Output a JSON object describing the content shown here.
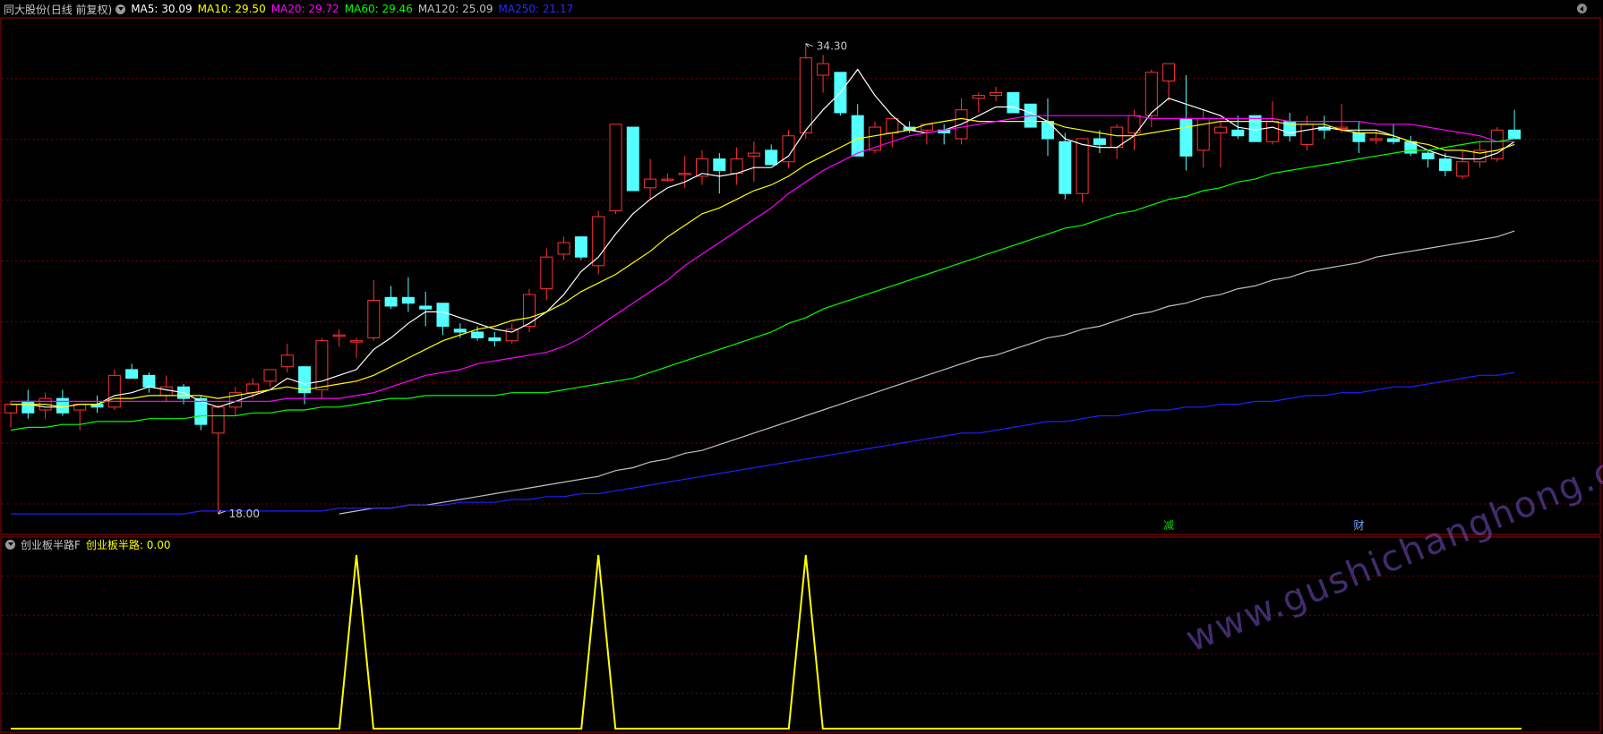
{
  "header": {
    "stock_name": "同大股份",
    "period": "(日线 前复权)",
    "ma5_label": "MA5:",
    "ma5_value": "30.09",
    "ma10_label": "MA10:",
    "ma10_value": "29.50",
    "ma20_label": "MA20:",
    "ma20_value": "29.72",
    "ma60_label": "MA60:",
    "ma60_value": "29.46",
    "ma120_label": "MA120:",
    "ma120_value": "25.09",
    "ma250_label": "MA250:",
    "ma250_value": "21.17"
  },
  "indicator": {
    "name": "创业板半路F",
    "line_label": "创业板半路:",
    "line_value": "0.00"
  },
  "markers": {
    "high_label": "34.30",
    "low_label": "18.00",
    "event1": "减",
    "event2": "财"
  },
  "watermark": "www.gushichanghong.com",
  "colors": {
    "up": "#ff3232",
    "down": "#54ffff",
    "ma5": "#ffffff",
    "ma10": "#ffff00",
    "ma20": "#ff00ff",
    "ma60": "#00ff00",
    "ma120": "#c0c0c0",
    "ma250": "#2020ff",
    "grid": "#7a0000",
    "indicator": "#ffff00"
  },
  "chart_data": [
    {
      "type": "candlestick",
      "title": "同大股份 (日线 前复权)",
      "y_range": [
        17.6,
        35.0
      ],
      "max_price": 34.3,
      "min_price": 18.0,
      "candles": [
        [
          21.5,
          21.9,
          21.0,
          21.8
        ],
        [
          21.9,
          22.3,
          21.3,
          21.5
        ],
        [
          21.6,
          22.2,
          21.3,
          22.0
        ],
        [
          22.0,
          22.3,
          21.4,
          21.5
        ],
        [
          21.6,
          21.8,
          20.9,
          21.8
        ],
        [
          21.8,
          22.1,
          21.5,
          21.7
        ],
        [
          21.7,
          23.0,
          21.6,
          22.8
        ],
        [
          23.0,
          23.2,
          22.7,
          22.7
        ],
        [
          22.8,
          22.9,
          22.2,
          22.4
        ],
        [
          22.1,
          22.8,
          21.9,
          22.4
        ],
        [
          22.4,
          22.5,
          21.8,
          22.0
        ],
        [
          22.0,
          22.1,
          20.9,
          21.1
        ],
        [
          20.8,
          21.8,
          18.0,
          21.7
        ],
        [
          21.7,
          22.4,
          21.4,
          22.2
        ],
        [
          22.2,
          22.7,
          22.0,
          22.5
        ],
        [
          22.6,
          23.0,
          22.4,
          23.0
        ],
        [
          23.1,
          23.9,
          22.9,
          23.5
        ],
        [
          23.1,
          22.2,
          21.8,
          22.2
        ],
        [
          22.3,
          24.1,
          22.0,
          24.0
        ],
        [
          24.2,
          24.4,
          23.8,
          24.2
        ],
        [
          24.0,
          24.1,
          23.4,
          24.0
        ],
        [
          24.1,
          26.1,
          24.0,
          25.4
        ],
        [
          25.5,
          25.9,
          25.1,
          25.2
        ],
        [
          25.5,
          26.2,
          25.0,
          25.3
        ],
        [
          25.2,
          25.7,
          24.5,
          25.1
        ],
        [
          25.3,
          25.3,
          24.2,
          24.5
        ],
        [
          24.4,
          24.6,
          24.1,
          24.3
        ],
        [
          24.3,
          24.5,
          24.0,
          24.1
        ],
        [
          24.1,
          24.3,
          23.8,
          24.0
        ],
        [
          24.0,
          24.6,
          23.9,
          24.4
        ],
        [
          24.5,
          25.8,
          24.3,
          25.6
        ],
        [
          25.8,
          27.2,
          25.4,
          26.9
        ],
        [
          27.0,
          27.6,
          26.8,
          27.4
        ],
        [
          27.6,
          27.4,
          26.8,
          26.9
        ],
        [
          26.6,
          28.5,
          26.3,
          28.3
        ],
        [
          28.5,
          31.3,
          28.4,
          31.5
        ],
        [
          31.4,
          31.2,
          29.5,
          29.2
        ],
        [
          29.3,
          30.3,
          28.9,
          29.6
        ],
        [
          29.6,
          29.8,
          29.5,
          29.6
        ],
        [
          29.8,
          30.4,
          29.3,
          29.8
        ],
        [
          29.7,
          30.6,
          29.4,
          30.3
        ],
        [
          30.3,
          30.5,
          29.1,
          29.9
        ],
        [
          29.8,
          30.7,
          29.4,
          30.3
        ],
        [
          30.4,
          30.9,
          29.5,
          30.5
        ],
        [
          30.6,
          30.8,
          30.4,
          30.1
        ],
        [
          30.2,
          31.3,
          30.0,
          31.1
        ],
        [
          31.2,
          34.3,
          31.0,
          33.8
        ],
        [
          33.2,
          33.9,
          32.6,
          33.6
        ],
        [
          33.3,
          33.1,
          31.8,
          31.9
        ],
        [
          31.8,
          32.2,
          31.6,
          30.4
        ],
        [
          30.6,
          31.6,
          30.5,
          31.4
        ],
        [
          31.2,
          31.6,
          30.7,
          31.7
        ],
        [
          31.4,
          31.6,
          31.2,
          31.3
        ],
        [
          31.3,
          31.5,
          30.8,
          31.5
        ],
        [
          31.3,
          31.5,
          30.8,
          31.2
        ],
        [
          31.0,
          32.4,
          30.8,
          32.0
        ],
        [
          32.4,
          32.6,
          31.9,
          32.5
        ],
        [
          32.5,
          32.8,
          32.3,
          32.6
        ],
        [
          32.6,
          32.6,
          31.9,
          31.9
        ],
        [
          32.2,
          32.2,
          31.4,
          31.4
        ],
        [
          31.6,
          32.4,
          30.4,
          31.0
        ],
        [
          30.9,
          31.2,
          28.9,
          29.1
        ],
        [
          29.1,
          31.0,
          28.8,
          31.0
        ],
        [
          31.0,
          31.3,
          30.5,
          30.8
        ],
        [
          30.7,
          31.5,
          30.3,
          31.4
        ],
        [
          31.2,
          32.0,
          30.6,
          31.8
        ],
        [
          31.8,
          33.4,
          31.4,
          33.3
        ],
        [
          33.0,
          33.6,
          32.3,
          33.6
        ],
        [
          31.7,
          33.2,
          29.9,
          30.4
        ],
        [
          30.6,
          32.0,
          30.0,
          31.7
        ],
        [
          31.2,
          31.6,
          30.0,
          31.4
        ],
        [
          31.3,
          31.8,
          31.0,
          31.1
        ],
        [
          31.8,
          31.5,
          30.9,
          30.9
        ],
        [
          30.9,
          32.3,
          30.8,
          31.6
        ],
        [
          31.6,
          31.9,
          30.9,
          31.1
        ],
        [
          30.8,
          31.8,
          30.6,
          31.5
        ],
        [
          31.4,
          31.8,
          31.0,
          31.3
        ],
        [
          31.4,
          32.2,
          31.2,
          31.4
        ],
        [
          31.2,
          31.6,
          30.5,
          30.9
        ],
        [
          31.0,
          31.3,
          30.8,
          31.0
        ],
        [
          31.0,
          31.5,
          30.8,
          30.9
        ],
        [
          30.9,
          31.1,
          30.4,
          30.5
        ],
        [
          30.5,
          30.6,
          30.0,
          30.3
        ],
        [
          30.3,
          30.5,
          29.7,
          29.9
        ],
        [
          29.7,
          30.6,
          29.6,
          30.2
        ],
        [
          30.2,
          30.9,
          30.0,
          30.6
        ],
        [
          30.3,
          31.4,
          30.2,
          31.3
        ],
        [
          31.3,
          32.0,
          31.0,
          31.0
        ]
      ],
      "ma_lines": [
        {
          "name": "MA5",
          "key": "ma5",
          "values": [
            21.8,
            21.8,
            21.7,
            21.7,
            21.8,
            21.8,
            22.1,
            22.2,
            22.4,
            22.3,
            22.2,
            21.9,
            21.7,
            21.9,
            22.1,
            22.3,
            22.7,
            22.5,
            22.6,
            22.8,
            23.0,
            23.7,
            24.1,
            24.6,
            25.0,
            25.0,
            24.8,
            24.6,
            24.4,
            24.3,
            24.6,
            25.0,
            25.6,
            26.4,
            26.9,
            27.7,
            28.4,
            28.9,
            29.3,
            29.5,
            29.8,
            29.7,
            29.8,
            30.0,
            30.0,
            30.4,
            31.3,
            32.0,
            32.6,
            33.4,
            32.5,
            31.8,
            31.3,
            31.2,
            31.3,
            31.5,
            31.8,
            32.1,
            32.1,
            31.9,
            31.6,
            31.0,
            30.8,
            30.7,
            30.7,
            31.1,
            31.9,
            32.4,
            32.2,
            32.0,
            31.8,
            31.4,
            31.3,
            31.4,
            31.2,
            31.3,
            31.4,
            31.3,
            31.3,
            31.3,
            31.1,
            30.9,
            30.6,
            30.4,
            30.3,
            30.3,
            30.5,
            30.9
          ]
        },
        {
          "name": "MA10",
          "key": "ma10",
          "values": [
            21.8,
            21.8,
            21.8,
            21.7,
            21.8,
            21.8,
            22.0,
            22.0,
            22.1,
            22.1,
            22.1,
            22.1,
            22.0,
            22.1,
            22.2,
            22.3,
            22.4,
            22.3,
            22.4,
            22.5,
            22.6,
            22.8,
            23.1,
            23.4,
            23.7,
            24.0,
            24.2,
            24.4,
            24.5,
            24.7,
            24.8,
            25.0,
            25.3,
            25.7,
            26.0,
            26.3,
            26.7,
            27.1,
            27.6,
            28.0,
            28.4,
            28.6,
            28.9,
            29.2,
            29.4,
            29.7,
            30.1,
            30.4,
            30.7,
            31.0,
            31.1,
            31.2,
            31.3,
            31.5,
            31.6,
            31.7,
            31.6,
            31.6,
            31.6,
            31.6,
            31.6,
            31.4,
            31.3,
            31.2,
            31.1,
            31.1,
            31.2,
            31.3,
            31.4,
            31.5,
            31.6,
            31.6,
            31.6,
            31.6,
            31.5,
            31.5,
            31.5,
            31.3,
            31.2,
            31.2,
            31.1,
            30.9,
            30.8,
            30.6,
            30.6,
            30.5,
            30.6,
            30.8
          ]
        },
        {
          "name": "MA20",
          "key": "ma20",
          "values": [
            21.9,
            21.9,
            21.9,
            21.9,
            21.9,
            21.9,
            21.9,
            21.9,
            21.9,
            21.9,
            21.9,
            21.9,
            21.9,
            21.9,
            21.9,
            21.9,
            22.0,
            22.0,
            22.0,
            22.0,
            22.1,
            22.2,
            22.4,
            22.6,
            22.8,
            22.9,
            23.0,
            23.2,
            23.3,
            23.4,
            23.5,
            23.6,
            23.8,
            24.1,
            24.5,
            24.9,
            25.3,
            25.7,
            26.1,
            26.6,
            27.0,
            27.4,
            27.8,
            28.2,
            28.6,
            29.1,
            29.5,
            29.9,
            30.2,
            30.5,
            30.7,
            30.9,
            31.1,
            31.2,
            31.3,
            31.4,
            31.5,
            31.6,
            31.7,
            31.8,
            31.8,
            31.8,
            31.8,
            31.8,
            31.8,
            31.8,
            31.7,
            31.7,
            31.7,
            31.7,
            31.7,
            31.7,
            31.7,
            31.7,
            31.6,
            31.6,
            31.6,
            31.6,
            31.6,
            31.5,
            31.5,
            31.5,
            31.4,
            31.3,
            31.2,
            31.1,
            30.9,
            30.9
          ]
        },
        {
          "name": "MA60",
          "key": "ma60",
          "values": [
            20.9,
            21.0,
            21.0,
            21.1,
            21.1,
            21.2,
            21.2,
            21.2,
            21.3,
            21.3,
            21.3,
            21.4,
            21.4,
            21.4,
            21.5,
            21.5,
            21.6,
            21.6,
            21.7,
            21.7,
            21.8,
            21.9,
            22.0,
            22.0,
            22.1,
            22.1,
            22.1,
            22.1,
            22.1,
            22.2,
            22.2,
            22.2,
            22.3,
            22.4,
            22.5,
            22.6,
            22.7,
            22.9,
            23.1,
            23.3,
            23.5,
            23.7,
            23.9,
            24.1,
            24.3,
            24.6,
            24.8,
            25.1,
            25.3,
            25.5,
            25.7,
            25.9,
            26.1,
            26.3,
            26.5,
            26.7,
            26.9,
            27.1,
            27.3,
            27.5,
            27.7,
            27.9,
            28.0,
            28.2,
            28.4,
            28.5,
            28.7,
            28.9,
            29.0,
            29.2,
            29.3,
            29.5,
            29.6,
            29.8,
            29.9,
            30.0,
            30.1,
            30.2,
            30.3,
            30.4,
            30.5,
            30.6,
            30.6,
            30.7,
            30.8,
            30.9,
            30.9,
            31.0
          ]
        },
        {
          "name": "MA120",
          "key": "ma120",
          "values": [
            null,
            null,
            null,
            null,
            null,
            null,
            null,
            null,
            null,
            null,
            null,
            null,
            null,
            null,
            null,
            null,
            null,
            null,
            null,
            18.0,
            18.1,
            18.2,
            18.2,
            18.3,
            18.3,
            18.4,
            18.5,
            18.6,
            18.7,
            18.8,
            18.9,
            19.0,
            19.1,
            19.2,
            19.3,
            19.5,
            19.6,
            19.8,
            19.9,
            20.1,
            20.2,
            20.4,
            20.6,
            20.8,
            21.0,
            21.2,
            21.4,
            21.6,
            21.8,
            22.0,
            22.2,
            22.4,
            22.6,
            22.8,
            23.0,
            23.2,
            23.4,
            23.5,
            23.7,
            23.9,
            24.1,
            24.2,
            24.4,
            24.5,
            24.7,
            24.9,
            25.0,
            25.2,
            25.3,
            25.5,
            25.6,
            25.8,
            25.9,
            26.1,
            26.2,
            26.4,
            26.5,
            26.6,
            26.7,
            26.9,
            27.0,
            27.1,
            27.2,
            27.3,
            27.4,
            27.5,
            27.6,
            27.8
          ]
        },
        {
          "name": "MA250",
          "key": "ma250",
          "values": [
            18.0,
            18.0,
            18.0,
            18.0,
            18.0,
            18.0,
            18.0,
            18.0,
            18.0,
            18.0,
            18.0,
            18.1,
            18.1,
            18.1,
            18.1,
            18.1,
            18.1,
            18.1,
            18.1,
            18.2,
            18.2,
            18.2,
            18.2,
            18.3,
            18.3,
            18.3,
            18.4,
            18.4,
            18.4,
            18.5,
            18.5,
            18.6,
            18.6,
            18.7,
            18.7,
            18.8,
            18.9,
            19.0,
            19.1,
            19.2,
            19.3,
            19.4,
            19.5,
            19.6,
            19.7,
            19.8,
            19.9,
            20.0,
            20.1,
            20.2,
            20.3,
            20.4,
            20.5,
            20.6,
            20.7,
            20.8,
            20.8,
            20.9,
            21.0,
            21.1,
            21.2,
            21.2,
            21.3,
            21.4,
            21.4,
            21.5,
            21.6,
            21.6,
            21.7,
            21.7,
            21.8,
            21.8,
            21.9,
            21.9,
            22.0,
            22.1,
            22.1,
            22.2,
            22.2,
            22.3,
            22.4,
            22.4,
            22.5,
            22.6,
            22.7,
            22.8,
            22.8,
            22.9
          ]
        }
      ]
    },
    {
      "type": "line",
      "title": "创业板半路F",
      "series_name": "创业板半路",
      "y_range": [
        0,
        1
      ],
      "signal_days": [
        20,
        34,
        46
      ],
      "values_length": 88
    }
  ]
}
